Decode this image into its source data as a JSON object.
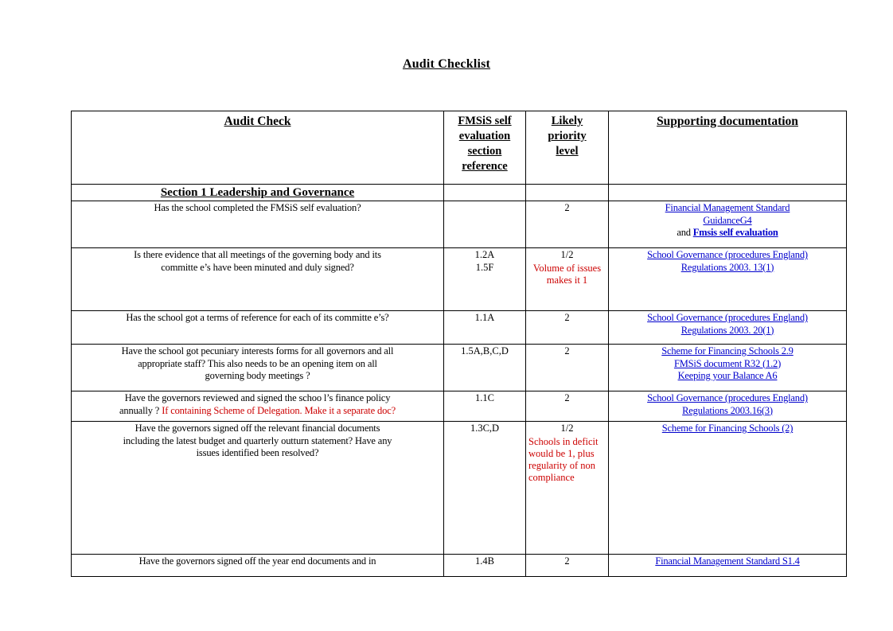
{
  "document": {
    "title": "Audit Checklist"
  },
  "table": {
    "headers": {
      "audit_check": "Audit Check",
      "fmsis_ref_line1": "FMSiS self",
      "fmsis_ref_line2": "evaluation",
      "fmsis_ref_line3": "section",
      "fmsis_ref_line4": "reference",
      "priority_line1": "Likely",
      "priority_line2": "priority",
      "priority_line3": "level",
      "supporting_documentation": "Supporting documentation"
    },
    "section_1": {
      "title": "Section 1 Leadership and Governance"
    },
    "rows": [
      {
        "check": "Has the school completed the FMSiS self evaluation?",
        "ref": "",
        "priority": "2",
        "priority_note": "",
        "docs": [
          {
            "text": "Financial Management Standard",
            "link": true,
            "bold": false
          },
          {
            "text": "GuidanceG4",
            "link": true,
            "bold": false
          },
          {
            "prefix": "and ",
            "text": "Fmsis self evaluation",
            "link": true,
            "bold": true
          }
        ]
      },
      {
        "check_line1": "Is there evidence that all meetings of the governing body and its",
        "check_line2": "committe e’s have been minuted and duly signed?",
        "ref_line1": "1.2A",
        "ref_line2": "1.5F",
        "priority": "1/2",
        "priority_note": "Volume of issues makes it 1",
        "priority_note_align": "center",
        "docs": [
          {
            "text": "School Governance (procedures England)",
            "link": true,
            "bold": false
          },
          {
            "text": "Regulations 2003. 13(1)",
            "link": true,
            "bold": false
          }
        ]
      },
      {
        "check": "Has the school got a terms of reference for each of its committe   e’s?",
        "ref": "1.1A",
        "priority": "2",
        "priority_note": "",
        "docs": [
          {
            "text": "School Governance (procedures England)",
            "link": true,
            "bold": false
          },
          {
            "text": "Regulations 2003. 20(1)",
            "link": true,
            "bold": false
          }
        ]
      },
      {
        "check_line1": "Have the school got pecuniary interests forms for all governors and all",
        "check_line2": "appropriate staff? This also needs to be an opening item on all",
        "check_line3": "governing body meetings   ?",
        "ref": "1.5A,B,C,D",
        "priority": "2",
        "priority_note": "",
        "docs": [
          {
            "text": "Scheme for Financing Schools 2.9",
            "link": true,
            "bold": false
          },
          {
            "text": "FMSiS document R32 (1.2)",
            "link": true,
            "bold": false
          },
          {
            "text": "Keeping your Balance A6",
            "link": true,
            "bold": false
          }
        ]
      },
      {
        "check_line1": "Have the governors reviewed and signed the schoo    l’s finance policy",
        "check_line2_black": "annually  ? ",
        "check_line2_red": "If containing Scheme of Delegation. Make it a separate doc?",
        "ref": "1.1C",
        "priority": "2",
        "priority_note": "",
        "docs": [
          {
            "text": "School Governance (procedures England)",
            "link": true,
            "bold": false
          },
          {
            "text": "Regulations 2003.16(3)",
            "link": true,
            "bold": false
          }
        ]
      },
      {
        "check_line1": "Have the governors signed off the relevant financial documents",
        "check_line2": "including the latest budget and quarterly outturn statement? Have any",
        "check_line3": "issues identified been resolved?",
        "ref": "1.3C,D",
        "priority": "1/2",
        "priority_note": "Schools in deficit would be 1, plus regularity of non compliance",
        "priority_note_align": "left",
        "docs": [
          {
            "text": "Scheme for Financing Schools (2)",
            "link": true,
            "bold": false
          }
        ]
      },
      {
        "check": "Have the governors signed off the year end documents and in",
        "ref": "1.4B",
        "priority": "2",
        "priority_note": "",
        "docs": [
          {
            "text": "Financial Management Standard S1.4",
            "link": true,
            "bold": false
          }
        ]
      }
    ]
  },
  "colors": {
    "link": "#0000CC",
    "note": "#CC0000",
    "text": "#000000",
    "border": "#000000"
  }
}
